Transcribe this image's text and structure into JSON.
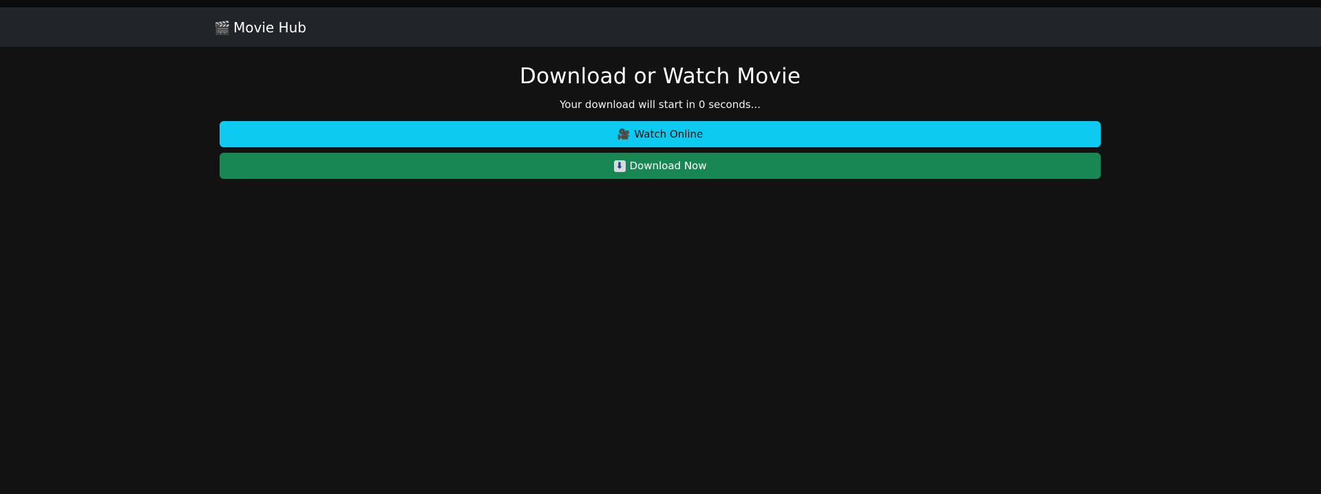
{
  "navbar": {
    "brand_icon": "clapper-board-icon",
    "brand_icon_glyph": "🎬",
    "brand_label": "Movie Hub"
  },
  "main": {
    "title": "Download or Watch Movie",
    "countdown_text": "Your download will start in 0 seconds..."
  },
  "buttons": {
    "watch": {
      "icon": "movie-camera-icon",
      "icon_glyph": "🎥",
      "label": "Watch Online",
      "color": "#0dcaf0"
    },
    "download": {
      "icon": "down-arrow-icon",
      "icon_glyph": "⬇",
      "label": "Download Now",
      "color": "#198754"
    }
  },
  "theme": {
    "background": "#121212",
    "navbar_background": "#212529"
  }
}
